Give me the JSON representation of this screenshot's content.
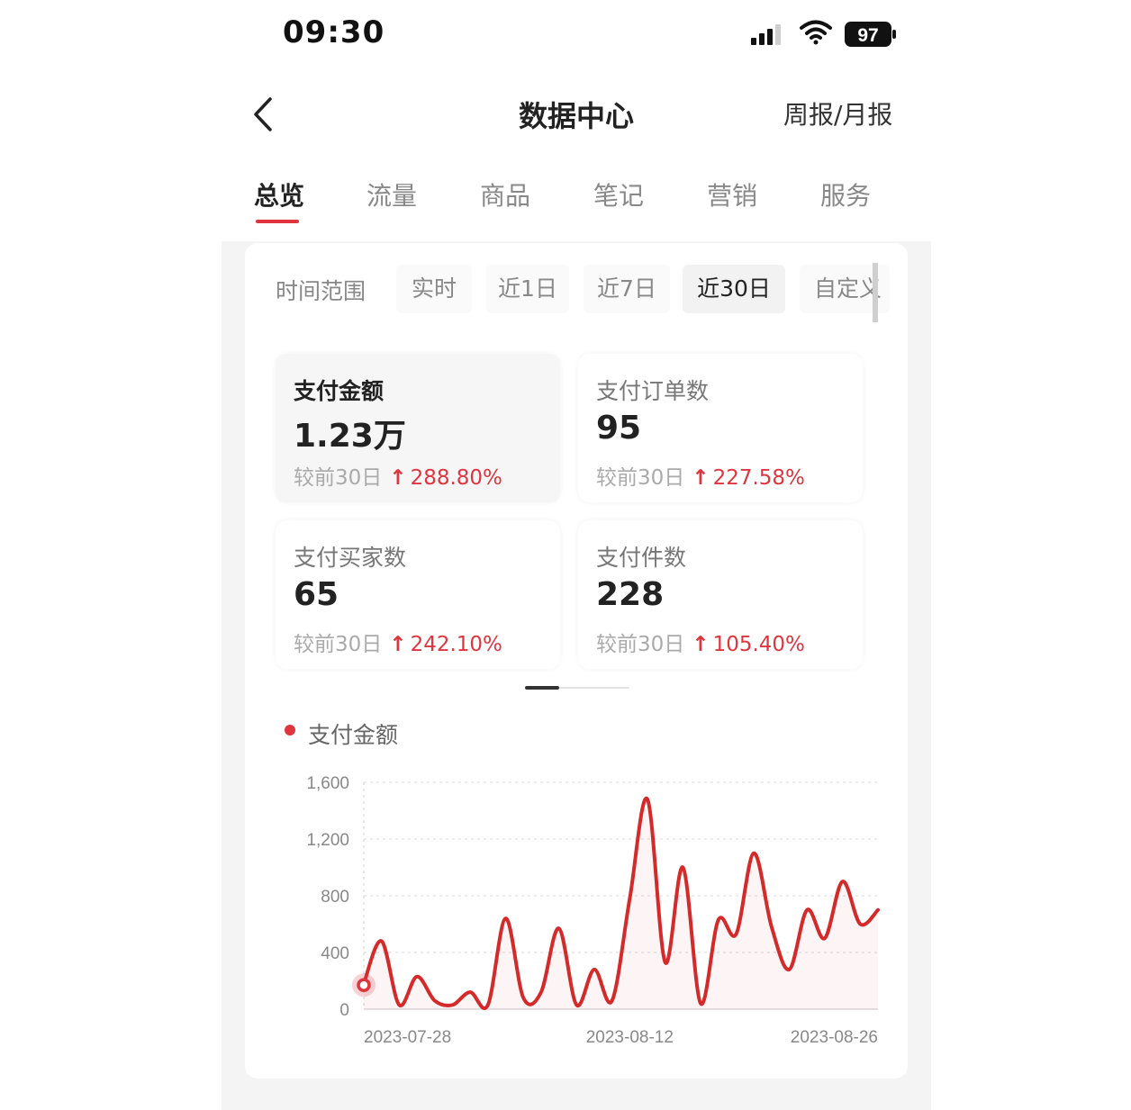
{
  "status_bar": {
    "time": "09:30",
    "battery": "97"
  },
  "nav": {
    "title": "数据中心",
    "right_link": "周报/月报"
  },
  "tabs": [
    {
      "label": "总览",
      "active": true
    },
    {
      "label": "流量",
      "active": false
    },
    {
      "label": "商品",
      "active": false
    },
    {
      "label": "笔记",
      "active": false
    },
    {
      "label": "营销",
      "active": false
    },
    {
      "label": "服务",
      "active": false
    }
  ],
  "time_range": {
    "label": "时间范围",
    "options": [
      "实时",
      "近1日",
      "近7日",
      "近30日",
      "自定义"
    ],
    "selected": "近30日"
  },
  "metrics": [
    {
      "label": "支付金额",
      "value": "1.23万",
      "compare_label": "较前30日",
      "change": "288.80%",
      "direction": "up",
      "active": true
    },
    {
      "label": "支付订单数",
      "value": "95",
      "compare_label": "较前30日",
      "change": "227.58%",
      "direction": "up",
      "active": false
    },
    {
      "label": "支付买家数",
      "value": "65",
      "compare_label": "较前30日",
      "change": "242.10%",
      "direction": "up",
      "active": false
    },
    {
      "label": "支付件数",
      "value": "228",
      "compare_label": "较前30日",
      "change": "105.40%",
      "direction": "up",
      "active": false
    }
  ],
  "colors": {
    "accent": "#e0353e",
    "line": "#d42a2a"
  },
  "chart_data": {
    "type": "line",
    "title": "",
    "xlabel": "",
    "ylabel": "",
    "x_tick_labels": [
      "2023-07-28",
      "2023-08-12",
      "2023-08-26"
    ],
    "y_tick_labels": [
      "1,600",
      "1,200",
      "800",
      "400",
      "0"
    ],
    "y_ticks": [
      1600,
      1200,
      800,
      400,
      0
    ],
    "ylim": [
      0,
      1600
    ],
    "grid": true,
    "legend": "top-left",
    "series": [
      {
        "name": "支付金额",
        "x": [
          "2023-07-28",
          "2023-07-29",
          "2023-07-30",
          "2023-07-31",
          "2023-08-01",
          "2023-08-02",
          "2023-08-03",
          "2023-08-04",
          "2023-08-05",
          "2023-08-06",
          "2023-08-07",
          "2023-08-08",
          "2023-08-09",
          "2023-08-10",
          "2023-08-11",
          "2023-08-12",
          "2023-08-13",
          "2023-08-14",
          "2023-08-15",
          "2023-08-16",
          "2023-08-17",
          "2023-08-18",
          "2023-08-19",
          "2023-08-20",
          "2023-08-21",
          "2023-08-22",
          "2023-08-23",
          "2023-08-24",
          "2023-08-25",
          "2023-08-26"
        ],
        "values": [
          180,
          480,
          30,
          230,
          60,
          30,
          120,
          30,
          640,
          80,
          120,
          570,
          30,
          280,
          60,
          780,
          1480,
          330,
          1000,
          40,
          630,
          530,
          1100,
          580,
          280,
          700,
          500,
          900,
          600,
          700
        ]
      }
    ]
  },
  "chart_marker": {
    "date": "2023-07-28",
    "value": 170
  }
}
